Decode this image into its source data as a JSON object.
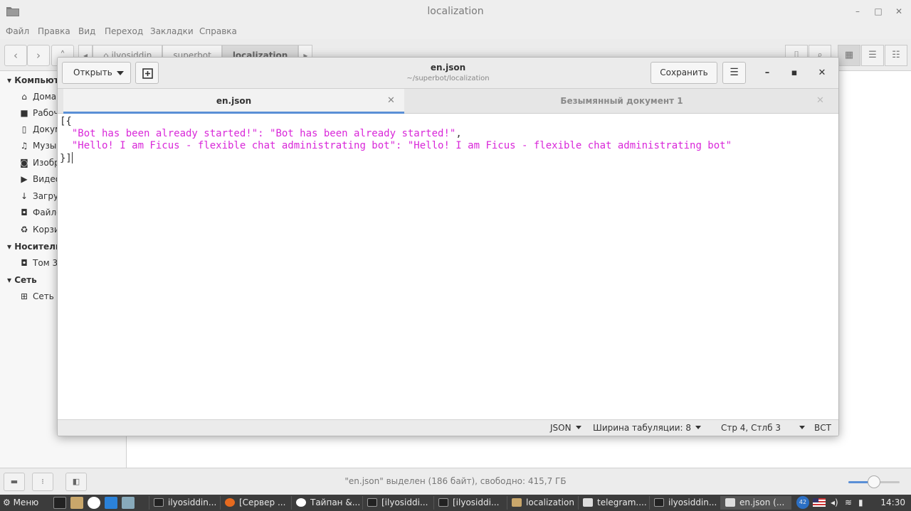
{
  "file_manager": {
    "title": "localization",
    "menu": [
      "Файл",
      "Правка",
      "Вид",
      "Переход",
      "Закладки",
      "Справка"
    ],
    "breadcrumbs": [
      "ilyosiddin",
      "superbot",
      "localization"
    ],
    "sidebar": {
      "computer_heading": "Компьютер",
      "computer_items": [
        {
          "label": "Домашняя папка",
          "icon": "home-icon"
        },
        {
          "label": "Рабочий стол",
          "icon": "folder-icon"
        },
        {
          "label": "Документы",
          "icon": "document-icon"
        },
        {
          "label": "Музыка",
          "icon": "music-icon"
        },
        {
          "label": "Изображения",
          "icon": "camera-icon"
        },
        {
          "label": "Видео",
          "icon": "video-icon"
        },
        {
          "label": "Загрузки",
          "icon": "download-icon"
        },
        {
          "label": "Файловая система",
          "icon": "drive-icon"
        },
        {
          "label": "Корзина",
          "icon": "trash-icon"
        }
      ],
      "devices_heading": "Носители",
      "devices_items": [
        {
          "label": "Том 30 ГБ",
          "icon": "drive-icon"
        }
      ],
      "network_heading": "Сеть",
      "network_items": [
        {
          "label": "Сеть",
          "icon": "network-icon"
        }
      ]
    },
    "status_text": "\"en.json\" выделен (186 байт), свободно: 415,7 ГБ",
    "zoom_fraction": 0.5
  },
  "editor": {
    "open_label": "Открыть",
    "title": "en.json",
    "subtitle": "~/superbot/localization",
    "save_label": "Сохранить",
    "tabs": [
      {
        "label": "en.json",
        "active": true
      },
      {
        "label": "Безымянный документ 1",
        "active": false
      }
    ],
    "code": {
      "line1": "[{",
      "line2_key": "\"Bot has been already started!\"",
      "line2_sep": ": ",
      "line2_val": "\"Bot has been already started!\"",
      "line2_end": ",",
      "line3_key": "\"Hello! I am Ficus - flexible chat administrating bot\"",
      "line3_sep": ": ",
      "line3_val": "\"Hello! I am Ficus - flexible chat administrating bot\"",
      "line4": "}]"
    },
    "status": {
      "language": "JSON",
      "tab_width": "Ширина табуляции: 8",
      "position": "Стр 4, Стлб 3",
      "insert_mode": "ВСТ"
    },
    "string_color": "#d927d9"
  },
  "taskbar": {
    "menu_label": "Меню",
    "tasks": [
      {
        "label": "ilyosiddin...",
        "icon": "terminal-icon"
      },
      {
        "label": "[Сервер ...",
        "icon": "firefox-icon"
      },
      {
        "label": "Тайпан &...",
        "icon": "app-icon"
      },
      {
        "label": "[ilyosiddi...",
        "icon": "terminal-icon"
      },
      {
        "label": "[ilyosiddi...",
        "icon": "terminal-icon"
      },
      {
        "label": "localization",
        "icon": "folder-icon"
      },
      {
        "label": "telegram....",
        "icon": "text-editor-icon"
      },
      {
        "label": "ilyosiddin...",
        "icon": "terminal-icon"
      },
      {
        "label": "en.json (...",
        "icon": "text-editor-icon"
      }
    ],
    "notification_count": "42",
    "clock": "14:30"
  }
}
